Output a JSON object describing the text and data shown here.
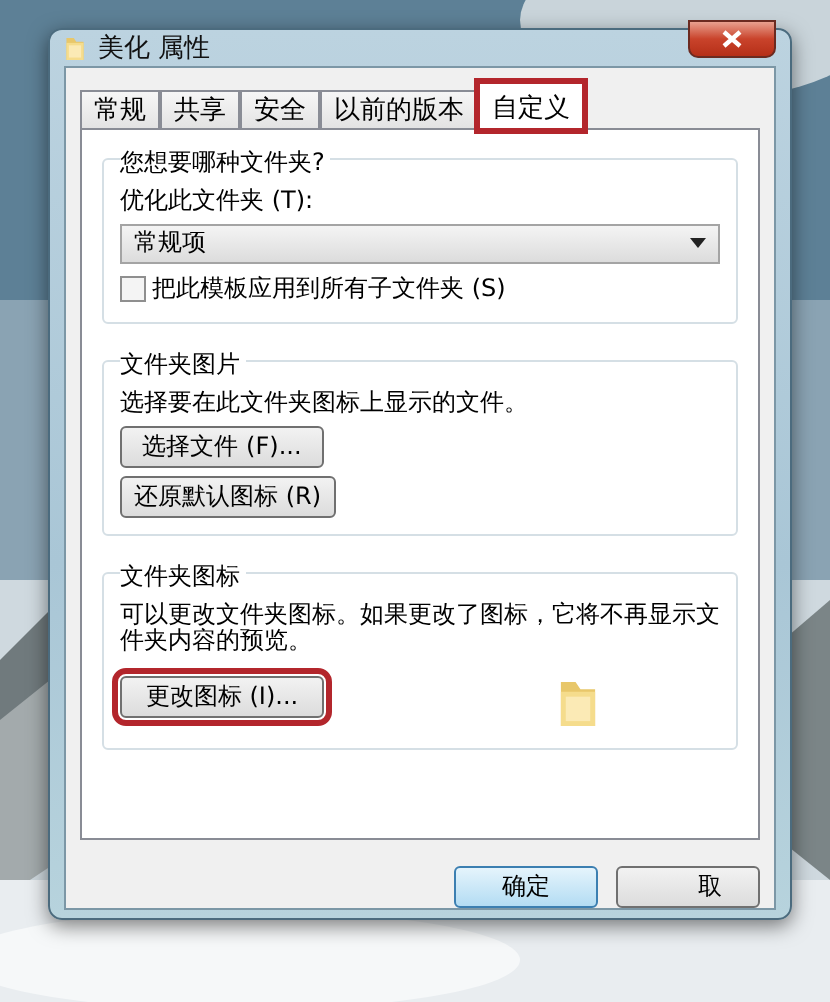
{
  "window": {
    "title": "美化 属性"
  },
  "tabs": [
    {
      "label": "常规",
      "selected": false,
      "highlighted": false
    },
    {
      "label": "共享",
      "selected": false,
      "highlighted": false
    },
    {
      "label": "安全",
      "selected": false,
      "highlighted": false
    },
    {
      "label": "以前的版本",
      "selected": false,
      "highlighted": false
    },
    {
      "label": "自定义",
      "selected": true,
      "highlighted": true
    }
  ],
  "groups": [
    {
      "title": "您想要哪种文件夹?",
      "items": [
        {
          "kind": "label",
          "text": "优化此文件夹 (T):"
        },
        {
          "kind": "dropdown",
          "value": "常规项"
        },
        {
          "kind": "checkbox",
          "text": "把此模板应用到所有子文件夹 (S)",
          "checked": false
        }
      ]
    },
    {
      "title": "文件夹图片",
      "items": [
        {
          "kind": "label",
          "text": "选择要在此文件夹图标上显示的文件。"
        },
        {
          "kind": "button",
          "text": "选择文件 (F)...",
          "highlighted": false
        },
        {
          "kind": "button",
          "text": "还原默认图标 (R)",
          "highlighted": false
        }
      ]
    },
    {
      "title": "文件夹图标",
      "items": [
        {
          "kind": "label",
          "text": "可以更改文件夹图标。如果更改了图标，它将不再显示文件夹内容的预览。"
        },
        {
          "kind": "button",
          "text": "更改图标 (I)...",
          "highlighted": true,
          "folder_preview": true
        }
      ]
    }
  ],
  "buttons": [
    {
      "label": "确定",
      "default": true
    },
    {
      "label": "取",
      "default": false
    }
  ]
}
